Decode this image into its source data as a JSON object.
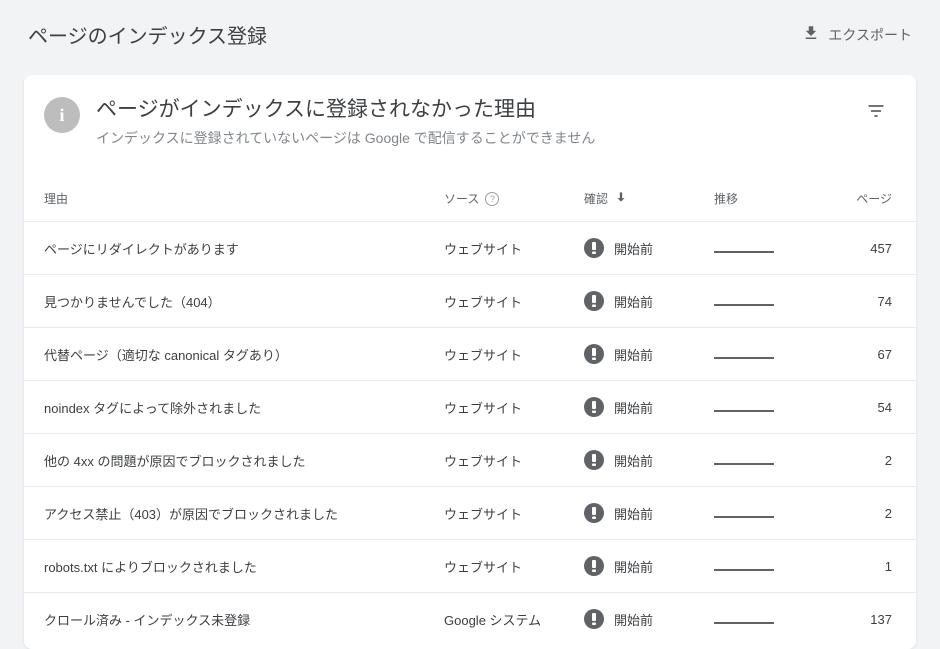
{
  "topbar": {
    "title": "ページのインデックス登録",
    "export": "エクスポート"
  },
  "card": {
    "info_glyph": "i",
    "title": "ページがインデックスに登録されなかった理由",
    "subtitle": "インデックスに登録されていないページは Google で配信することができません"
  },
  "columns": {
    "reason": "理由",
    "source": "ソース",
    "check": "確認",
    "trend": "推移",
    "pages": "ページ"
  },
  "rows": [
    {
      "reason": "ページにリダイレクトがあります",
      "source": "ウェブサイト",
      "check": "開始前",
      "pages": "457"
    },
    {
      "reason": "見つかりませんでした（404）",
      "source": "ウェブサイト",
      "check": "開始前",
      "pages": "74"
    },
    {
      "reason": "代替ページ（適切な canonical タグあり）",
      "source": "ウェブサイト",
      "check": "開始前",
      "pages": "67"
    },
    {
      "reason": "noindex タグによって除外されました",
      "source": "ウェブサイト",
      "check": "開始前",
      "pages": "54"
    },
    {
      "reason": "他の 4xx の問題が原因でブロックされました",
      "source": "ウェブサイト",
      "check": "開始前",
      "pages": "2"
    },
    {
      "reason": "アクセス禁止（403）が原因でブロックされました",
      "source": "ウェブサイト",
      "check": "開始前",
      "pages": "2"
    },
    {
      "reason": "robots.txt によりブロックされました",
      "source": "ウェブサイト",
      "check": "開始前",
      "pages": "1"
    },
    {
      "reason": "クロール済み - インデックス未登録",
      "source": "Google システム",
      "check": "開始前",
      "pages": "137"
    }
  ]
}
